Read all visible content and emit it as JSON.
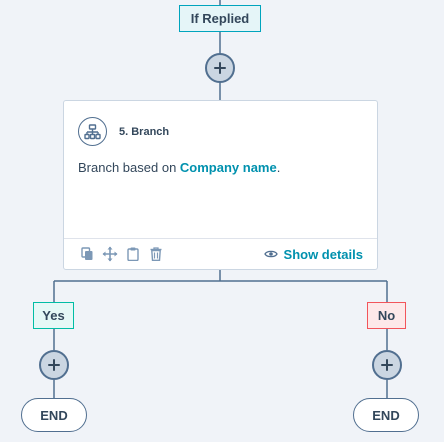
{
  "workflow": {
    "top_label": "If Replied",
    "card": {
      "title": "5. Branch",
      "desc_prefix": "Branch based on ",
      "desc_property": "Company name",
      "desc_suffix": ".",
      "show_details": "Show details",
      "icons": [
        "clone-icon",
        "move-icon",
        "clipboard-icon",
        "trash-icon"
      ]
    },
    "branches": {
      "left_label": "Yes",
      "right_label": "No",
      "left_end": "END",
      "right_end": "END"
    }
  },
  "colors": {
    "background": "#f0f3f8",
    "connector": "#516f90",
    "accent_link": "#0091ae",
    "yes_border": "#00bda5",
    "no_border": "#f2545b",
    "label_border": "#00a4bd"
  }
}
